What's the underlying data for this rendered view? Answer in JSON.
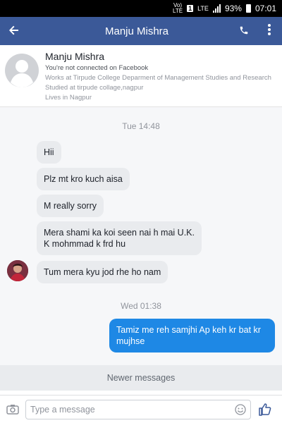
{
  "status_bar": {
    "network_top": "Vo)",
    "network_bottom": "LTE",
    "sim": "1",
    "lte": "LTE",
    "battery": "93%",
    "time": "07:01"
  },
  "header": {
    "title": "Manju Mishra",
    "icons": [
      "back-arrow-icon",
      "phone-icon",
      "more-vert-icon"
    ]
  },
  "profile": {
    "name": "Manju Mishra",
    "connection": "You're not connected on Facebook",
    "work": "Works at Tirpude College Deparment of Management Studies and Research",
    "study": "Studied at tirpude collage,nagpur",
    "location": "Lives in Nagpur"
  },
  "conversation": {
    "sep1": "Tue 14:48",
    "sep2": "Wed 01:38",
    "messages": [
      {
        "dir": "in",
        "text": "Hii"
      },
      {
        "dir": "in",
        "text": "Plz mt kro kuch aisa"
      },
      {
        "dir": "in",
        "text": "M really sorry"
      },
      {
        "dir": "in",
        "text": "Mera shami ka koi seen nai h mai U.K. K mohmmad k frd hu"
      },
      {
        "dir": "in",
        "text": "Tum mera kyu jod rhe ho nam"
      },
      {
        "dir": "out",
        "text": "Tamiz me reh samjhi Ap keh kr bat kr mujhse"
      }
    ]
  },
  "newer_messages": "Newer messages",
  "composer": {
    "placeholder": "Type a message",
    "icons": [
      "camera-icon",
      "emoji-icon",
      "like-icon"
    ]
  },
  "colors": {
    "brand": "#3b5998",
    "outgoing_bubble": "#1e88e5",
    "incoming_bubble": "#e9ebee"
  }
}
